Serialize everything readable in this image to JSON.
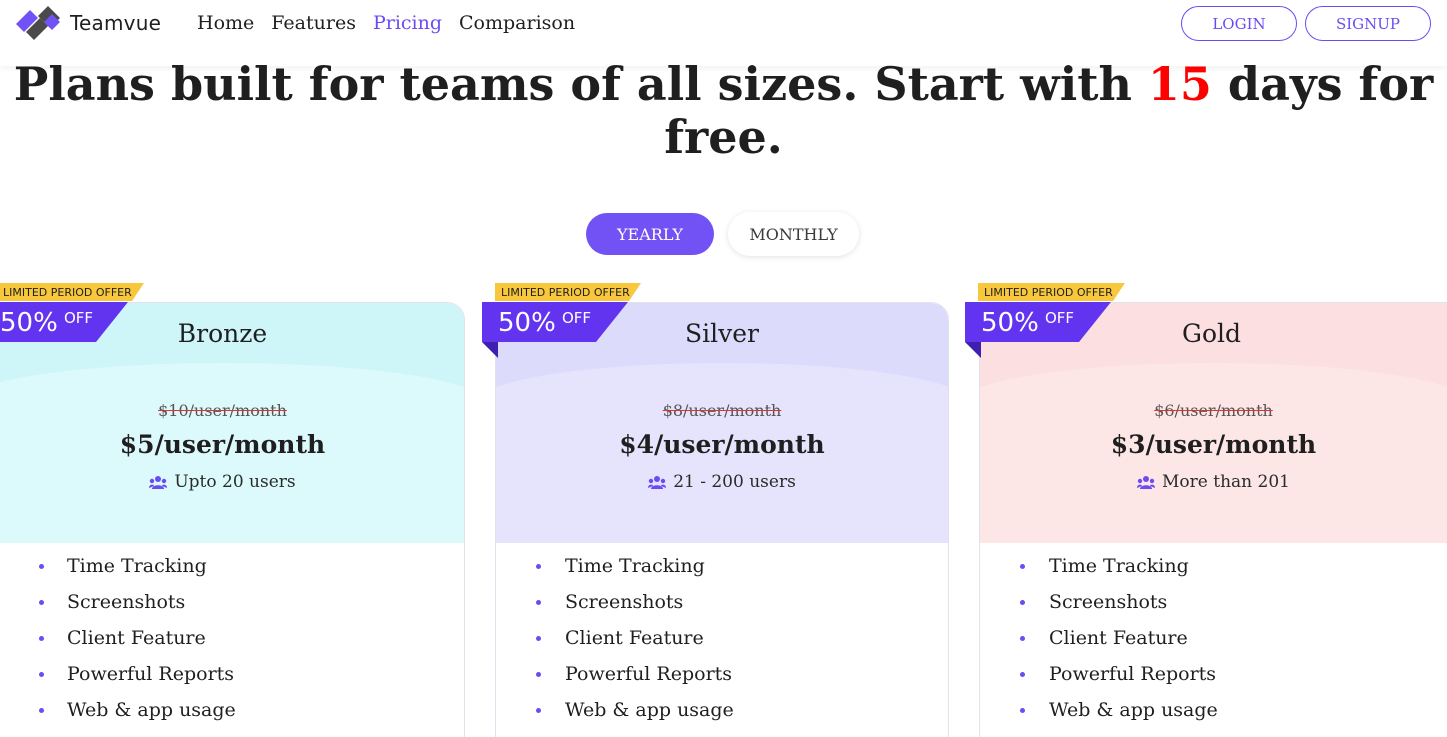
{
  "header": {
    "brand": "Teamvue",
    "nav": [
      "Home",
      "Features",
      "Pricing",
      "Comparison"
    ],
    "active_nav": "Pricing",
    "login_label": "LOGIN",
    "signup_label": "SIGNUP",
    "accent_color": "#6c4cf2"
  },
  "headline": {
    "before": "Plans built for teams of all sizes. Start with ",
    "highlight": "15",
    "after": " days for free.",
    "highlight_color": "#ff0000"
  },
  "billing_toggle": {
    "yearly_label": "YEARLY",
    "monthly_label": "MONTHLY",
    "selected": "YEARLY"
  },
  "plans": [
    {
      "ribbon": "LIMITED PERIOD OFFER",
      "discount": "50%",
      "discount_suffix": "OFF",
      "name": "Bronze",
      "old_price": "$10/user/month",
      "price": "$5/user/month",
      "users": "Upto 20 users",
      "top_color": "#cef5f8",
      "arc_color": "#dcfafc",
      "features": [
        "Time Tracking",
        "Screenshots",
        "Client Feature",
        "Powerful Reports",
        "Web & app usage"
      ]
    },
    {
      "ribbon": "LIMITED PERIOD OFFER",
      "discount": "50%",
      "discount_suffix": "OFF",
      "name": "Silver",
      "old_price": "$8/user/month",
      "price": "$4/user/month",
      "users": "21 - 200 users",
      "top_color": "#dcdbfb",
      "arc_color": "#e5e4fc",
      "features": [
        "Time Tracking",
        "Screenshots",
        "Client Feature",
        "Powerful Reports",
        "Web & app usage"
      ]
    },
    {
      "ribbon": "LIMITED PERIOD OFFER",
      "discount": "50%",
      "discount_suffix": "OFF",
      "name": "Gold",
      "old_price": "$6/user/month",
      "price": "$3/user/month",
      "users": "More than 201",
      "top_color": "#fcdfe1",
      "arc_color": "#fde6e6",
      "features": [
        "Time Tracking",
        "Screenshots",
        "Client Feature",
        "Powerful Reports",
        "Web & app usage"
      ]
    }
  ]
}
